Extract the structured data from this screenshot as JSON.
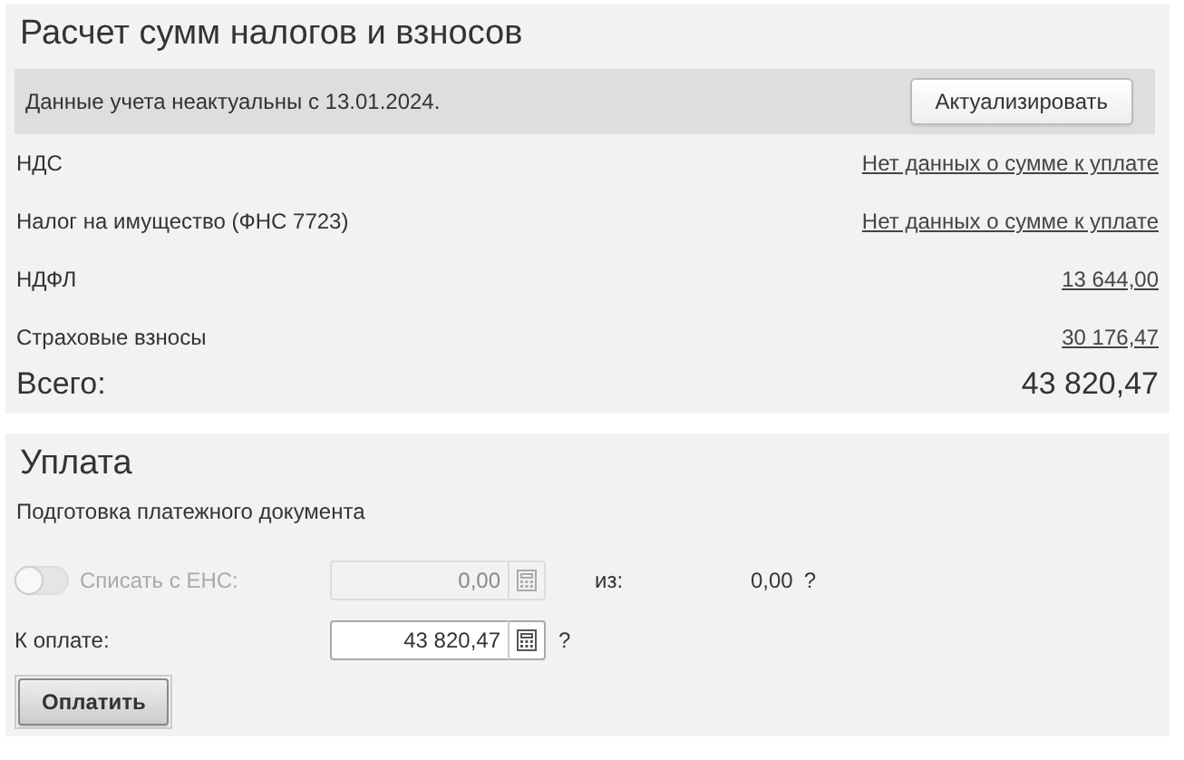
{
  "calculation": {
    "title": "Расчет сумм налогов и взносов",
    "notice": {
      "text": "Данные учета неактуальны с 13.01.2024.",
      "button": "Актуализировать"
    },
    "rows": [
      {
        "label": "НДС",
        "value": "Нет данных о сумме к уплате"
      },
      {
        "label": "Налог на имущество (ФНС 7723)",
        "value": "Нет данных о сумме к уплате"
      },
      {
        "label": "НДФЛ",
        "value": "13 644,00"
      },
      {
        "label": "Страховые взносы",
        "value": "30 176,47"
      }
    ],
    "total": {
      "label": "Всего:",
      "value": "43 820,47"
    }
  },
  "payment": {
    "title": "Уплата",
    "subtitle": "Подготовка платежного документа",
    "ens": {
      "label": "Списать с ЕНС:",
      "on": false,
      "disabled": true,
      "value": "0,00",
      "of_label": "из:",
      "of_value": "0,00",
      "help": "?"
    },
    "to_pay": {
      "label": "К оплате:",
      "value": "43 820,47",
      "help": "?"
    },
    "button": "Оплатить"
  }
}
